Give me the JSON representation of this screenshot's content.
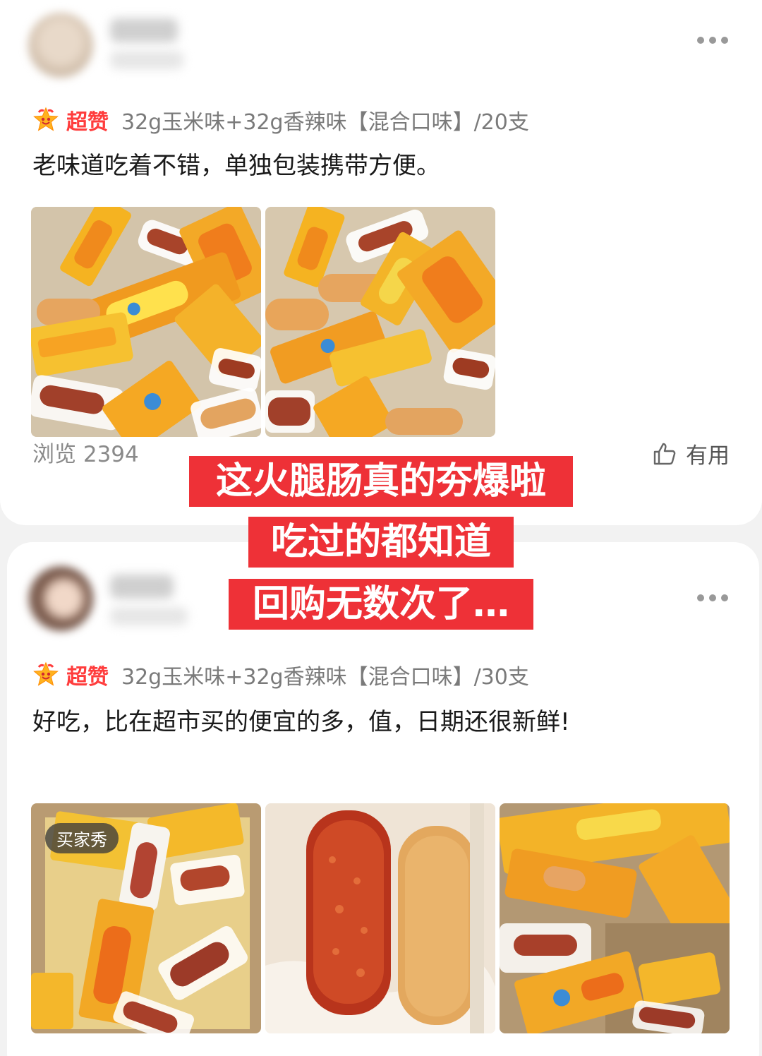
{
  "reviews": [
    {
      "rating_label": "超赞",
      "variant": "32g玉米味+32g香辣味【混合口味】/20支",
      "text": "老味道吃着不错，单独包装携带方便。",
      "views_label": "浏览 2394",
      "useful_label": "有用"
    },
    {
      "rating_label": "超赞",
      "variant": "32g玉米味+32g香辣味【混合口味】/30支",
      "text": "好吃，比在超市买的便宜的多，值，日期还很新鲜!",
      "buyer_show_tag": "买家秀"
    }
  ],
  "overlay": {
    "lines": [
      "这火腿肠真的夯爆啦",
      "吃过的都知道",
      "回购无数次了…"
    ],
    "background": "#ee3137"
  },
  "icons": {
    "more": "more-dots-icon",
    "rating": "smiling-star-icon",
    "useful": "thumbs-up-icon"
  },
  "colors": {
    "rating": "#ff3d3d",
    "card": "#ffffff",
    "page": "#f2f2f2"
  }
}
